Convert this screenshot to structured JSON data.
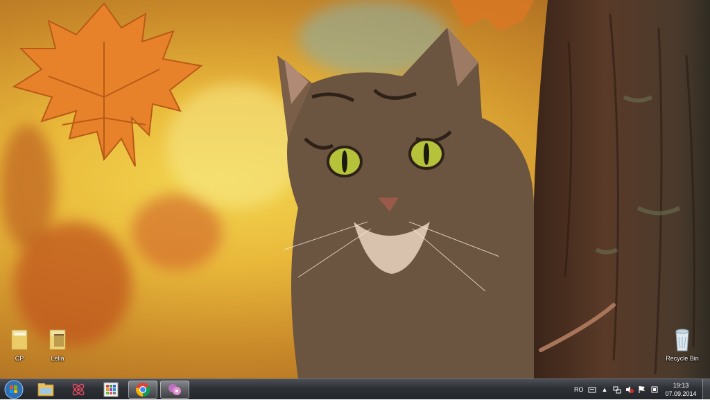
{
  "desktop": {
    "wallpaper": "cat-behind-tree-autumn",
    "icons": [
      {
        "name": "folder-icon",
        "label": "CP"
      },
      {
        "name": "folder-icon",
        "label": "Lelia"
      },
      {
        "name": "recycle-bin-icon",
        "label": "Recycle Bin"
      }
    ]
  },
  "taskbar": {
    "start_icon": "windows-start-icon",
    "pinned": [
      {
        "name": "file-explorer-icon"
      },
      {
        "name": "atom-app-icon"
      },
      {
        "name": "control-panel-icon"
      },
      {
        "name": "chrome-icon"
      },
      {
        "name": "messenger-icon"
      }
    ],
    "tray": {
      "language": "RO"
    },
    "clock": {
      "time": "19:13",
      "date": "07.09.2014"
    }
  },
  "colors": {
    "taskbar": "#2d3035",
    "wallpaper_yellow": "#f3d650",
    "leaf_orange": "#e07a22"
  }
}
